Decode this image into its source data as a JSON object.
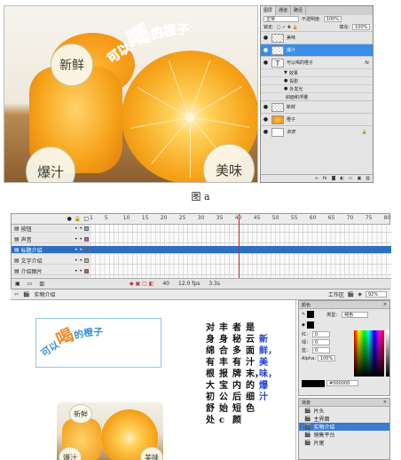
{
  "figure_a": {
    "badges": {
      "xinxian": "新鲜",
      "baozhi": "爆汁",
      "meiwei": "美味"
    },
    "title_arc": {
      "prefix": "可以",
      "big": "喝",
      "suffix": "的橙子"
    },
    "layers_panel": {
      "tabs": [
        "图层",
        "通道",
        "路径"
      ],
      "blend_mode": "正常",
      "opacity_label": "不透明度:",
      "opacity_value": "100%",
      "lock_label": "锁定:",
      "fill_label": "填充:",
      "fill_value": "100%",
      "layers": [
        {
          "name": "美味",
          "selected": false
        },
        {
          "name": "爆汁",
          "selected": true
        },
        {
          "name": "可以喝的橙子",
          "selected": false,
          "fx": "fx"
        },
        {
          "name": "新鲜",
          "selected": false
        },
        {
          "name": "橙子",
          "selected": false
        },
        {
          "name": "背景",
          "selected": false
        }
      ],
      "effects_label": "效果",
      "effects": [
        "投影",
        "外发光",
        "斜面和浮雕"
      ]
    },
    "caption": "图 a"
  },
  "figure_b": {
    "timeline": {
      "frame_ticks": [
        "1",
        "5",
        "10",
        "15",
        "20",
        "25",
        "30",
        "35",
        "40",
        "45",
        "50",
        "55",
        "60",
        "65",
        "70",
        "75",
        "80"
      ],
      "layers": [
        {
          "name": "按钮",
          "selected": false,
          "color": "#3bd0c8"
        },
        {
          "name": "声音",
          "selected": false,
          "color": "#e040e0"
        },
        {
          "name": "标题介绍",
          "selected": true,
          "color": "#3b5fd0"
        },
        {
          "name": "文字介绍",
          "selected": false,
          "color": "#c8d030"
        },
        {
          "name": "介绍图片",
          "selected": false,
          "color": "#e05050"
        }
      ],
      "current_frame": "40",
      "fps": "12.0 fps",
      "time": "3.3s"
    },
    "editbar": {
      "scene_name": "实物介绍",
      "workspace_label": "工作区",
      "zoom": "92%"
    },
    "stage": {
      "title_arc": {
        "prefix": "可以",
        "big": "喝",
        "suffix": "的橙子"
      },
      "text_columns": [
        {
          "text": "对身绵有根大初舒处",
          "blue": false
        },
        {
          "text": "丰身合丰报宝公始c",
          "blue": false
        },
        {
          "text": "者秘多有牌内后短颜",
          "blue": false
        },
        {
          "text": "是云面汁末，的细色",
          "blue": false
        },
        {
          "text": "新鲜，美味，爆汁",
          "blue": true
        }
      ],
      "photo_badges": {
        "xinxian": "新鲜",
        "baozhi": "爆汁",
        "meiwei": "美味"
      }
    },
    "color_panel": {
      "title": "颜色",
      "type_label": "类型：",
      "type_value": "纯色",
      "r_label": "红：",
      "r_value": "0",
      "g_label": "绿：",
      "g_value": "0",
      "b_label": "蓝：",
      "b_value": "0",
      "alpha_label": "Alpha:",
      "alpha_value": "100%",
      "hex": "#000000"
    },
    "scene_panel": {
      "title": "场景",
      "scenes": [
        {
          "name": "片头",
          "selected": false
        },
        {
          "name": "主界面",
          "selected": false
        },
        {
          "name": "实物介绍",
          "selected": true
        },
        {
          "name": "销售平台",
          "selected": false
        },
        {
          "name": "片尾",
          "selected": false
        }
      ]
    }
  }
}
